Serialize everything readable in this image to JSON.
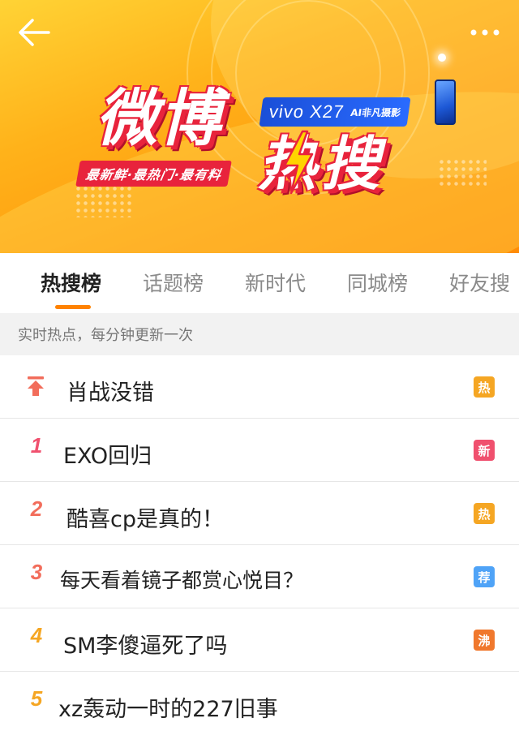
{
  "banner": {
    "title_main": "微博",
    "title_hot": "热搜",
    "slogan": "最新鲜·最热门·最有料",
    "sponsor_model": "vivo X27",
    "sponsor_tag": "AI非凡摄影",
    "colors": {
      "accent_red": "#e8233c",
      "sponsor_blue": "#1a4fd8",
      "background": "#ffb21a"
    }
  },
  "header": {
    "back_icon": "back-arrow-icon",
    "more_icon": "more-dots-icon"
  },
  "tabs": [
    {
      "label": "热搜榜",
      "active": true
    },
    {
      "label": "话题榜",
      "active": false
    },
    {
      "label": "新时代",
      "active": false
    },
    {
      "label": "同城榜",
      "active": false
    },
    {
      "label": "好友搜",
      "active": false
    }
  ],
  "notice": "实时热点，每分钟更新一次",
  "list": [
    {
      "rank": "",
      "rank_icon": "pin-top-icon",
      "title": "肖战没错",
      "badge": "热",
      "badge_color": "#f5a623"
    },
    {
      "rank": "1",
      "title": "EXO回归",
      "badge": "新",
      "badge_color": "#f0506e"
    },
    {
      "rank": "2",
      "title": "酷喜cp是真的！",
      "badge": "热",
      "badge_color": "#f5a623"
    },
    {
      "rank": "3",
      "title": "每天看着镜子都赏心悦目？",
      "badge": "荐",
      "badge_color": "#4fa3f7"
    },
    {
      "rank": "4",
      "title": "SM李傻逼死了吗",
      "badge": "沸",
      "badge_color": "#f0782d"
    },
    {
      "rank": "5",
      "title": "xz轰动一时的227旧事",
      "badge": "",
      "badge_color": ""
    }
  ],
  "rank_colors": {
    "1": "#f0506e",
    "2": "#f26d5b",
    "3": "#f26d5b",
    "4": "#f5a623",
    "5": "#f5a623"
  }
}
